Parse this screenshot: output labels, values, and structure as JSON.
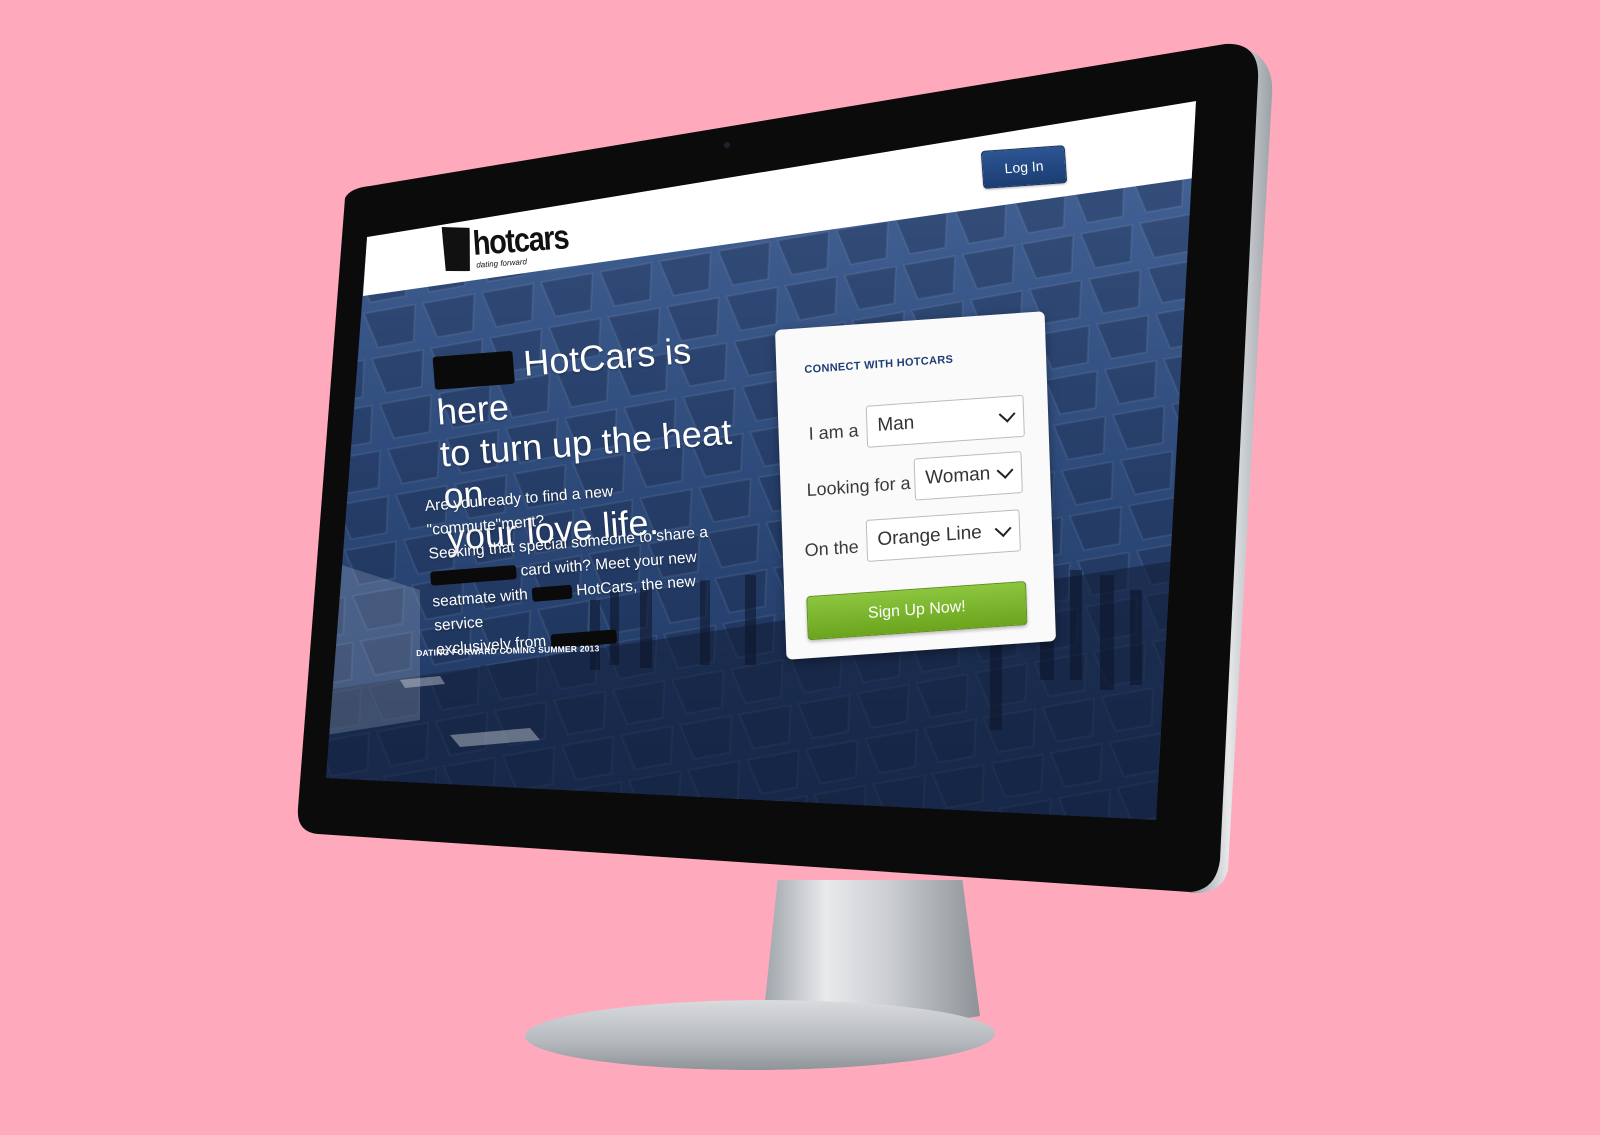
{
  "header": {
    "logo_text": "hotcars",
    "logo_tagline": "dating forward",
    "login_label": "Log In"
  },
  "hero": {
    "headline_line1": "HotCars is here",
    "headline_line2": "to turn up the heat on",
    "headline_line3": "your love life.",
    "body_line1": "Are you ready to find a new \"commute\"ment?",
    "body_line2": "Seeking that special someone to share a",
    "body_line3": "card with? Meet your new",
    "body_line4a": "seatmate with",
    "body_line4b": "HotCars, the new service",
    "body_line5": "exclusively from",
    "coming_soon": "DATING FORWARD COMING SUMMER 2013"
  },
  "signup": {
    "title": "CONNECT WITH HOTCARS",
    "gender_label": "I am a",
    "gender_value": "Man",
    "seeking_label": "Looking for a",
    "seeking_value": "Woman",
    "line_label": "On the",
    "line_value": "Orange Line",
    "submit_label": "Sign Up Now!"
  },
  "colors": {
    "background": "#ffa9bd",
    "brand_blue": "#1f3f74",
    "cta_green": "#7ab82e"
  }
}
